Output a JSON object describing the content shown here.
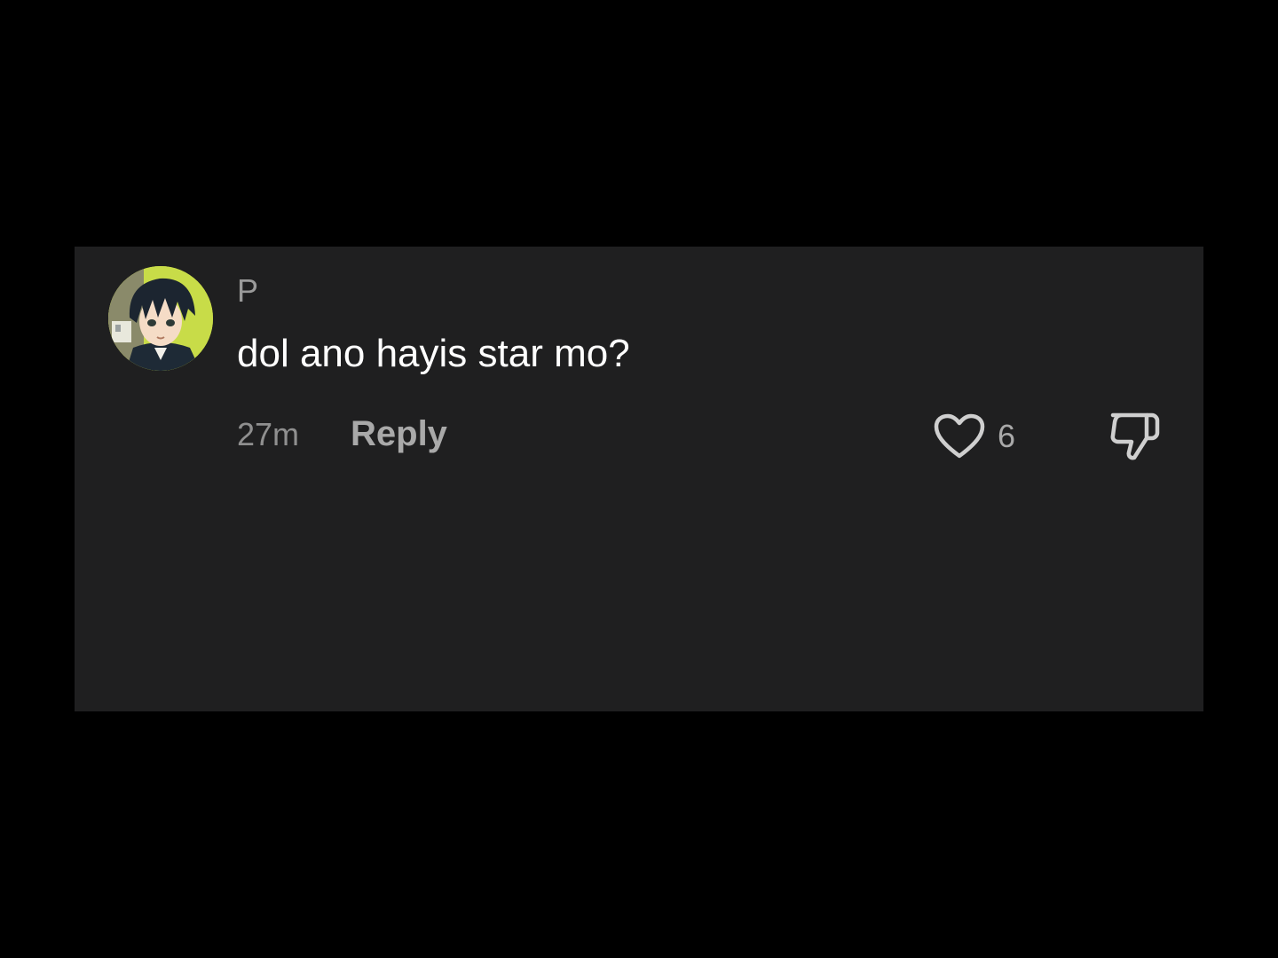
{
  "comment": {
    "username": "P",
    "text": "dol ano hayis star mo?",
    "timestamp": "27m",
    "reply_label": "Reply",
    "like_count": "6",
    "icons": {
      "like": "heart-icon",
      "dislike": "thumbs-down-icon"
    },
    "colors": {
      "card_background": "#1f1f20",
      "page_background": "#000000",
      "text_primary": "#ffffff",
      "text_secondary": "#a9a9a9",
      "avatar_background": "#c8dc48"
    }
  }
}
